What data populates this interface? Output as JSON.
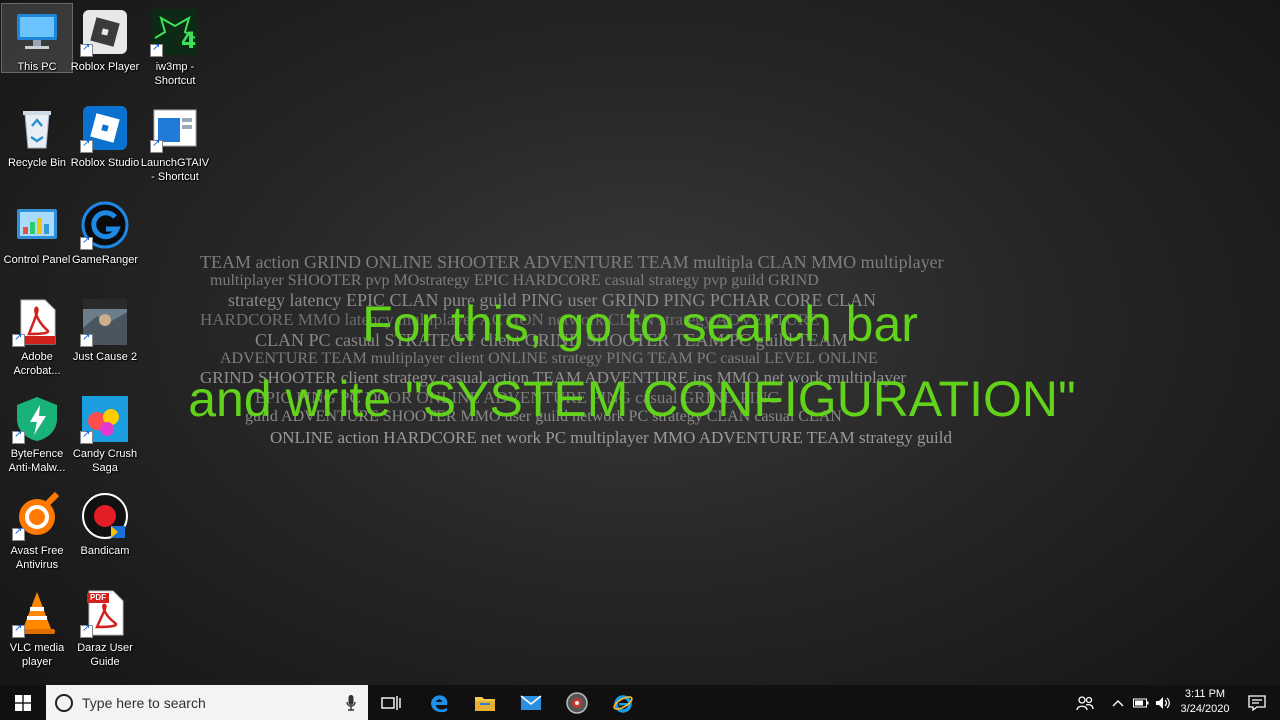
{
  "desktop": {
    "icons": [
      {
        "label": "This PC",
        "icon": "this-pc-icon"
      },
      {
        "label": "Roblox Player",
        "icon": "roblox-player-icon"
      },
      {
        "label": "iw3mp - Shortcut",
        "icon": "iw3mp-icon"
      },
      {
        "label": "Recycle Bin",
        "icon": "recycle-bin-icon"
      },
      {
        "label": "Roblox Studio",
        "icon": "roblox-studio-icon"
      },
      {
        "label": "LaunchGTAIV - Shortcut",
        "icon": "launchgtaiv-icon"
      },
      {
        "label": "Control Panel",
        "icon": "control-panel-icon"
      },
      {
        "label": "GameRanger",
        "icon": "gameranger-icon"
      },
      {
        "label": "Adobe Acrobat...",
        "icon": "adobe-acrobat-icon"
      },
      {
        "label": "Just Cause 2",
        "icon": "just-cause-2-icon"
      },
      {
        "label": "ByteFence Anti-Malw...",
        "icon": "bytefence-icon"
      },
      {
        "label": "Candy Crush Saga",
        "icon": "candy-crush-icon"
      },
      {
        "label": "Avast Free Antivirus",
        "icon": "avast-icon"
      },
      {
        "label": "Bandicam",
        "icon": "bandicam-icon"
      },
      {
        "label": "VLC media player",
        "icon": "vlc-icon"
      },
      {
        "label": "Daraz User Guide",
        "icon": "pdf-icon"
      }
    ],
    "pdf_badge": "PDF"
  },
  "caption": {
    "line1": "For this, go to search bar",
    "line2": "and write \"SYSTEM CONFIGURATION\"",
    "color": "#63d21b"
  },
  "wallpaper": {
    "rows": [
      "TEAM action  GRIND ONLINE SHOOTER ADVENTURE TEAM multipla  CLAN  MMO multiplayer",
      "multiplayer SHOOTER pvp MOstrategy EPIC HARDCORE casual strategy pvp guild GRIND",
      "strategy latency EPIC CLAN pure guild PING user GRIND PING PCHAR CORE CLAN",
      "HARDCORE MMO latency multiplayer ACTION network  CLAN strategy ADVENTURE",
      "CLAN PC  casual STRATEGY client GRIND SHOOTER TEAM PC guild TEAM",
      "ADVENTURE TEAM  multiplayer client ONLINE strategy PING TEAM PC casual LEVEL ONLINE",
      "GRIND SHOOTER client strategy casual action TEAM ADVENTURE ips MMO net work multiplayer",
      "EPIC PING PC DCOR ONLINE ADVENTURE PING casual GRIND PING",
      "guild ADVENTURE SHOOTER MMO user guild network PC strategy CLAN casual CLAN",
      "ONLINE action HARDCORE net work PC multiplayer MMO ADVENTURE TEAM strategy guild"
    ]
  },
  "taskbar": {
    "search_placeholder": "Type here to search",
    "clock_time": "3:11 PM",
    "clock_date": "3/24/2020"
  }
}
